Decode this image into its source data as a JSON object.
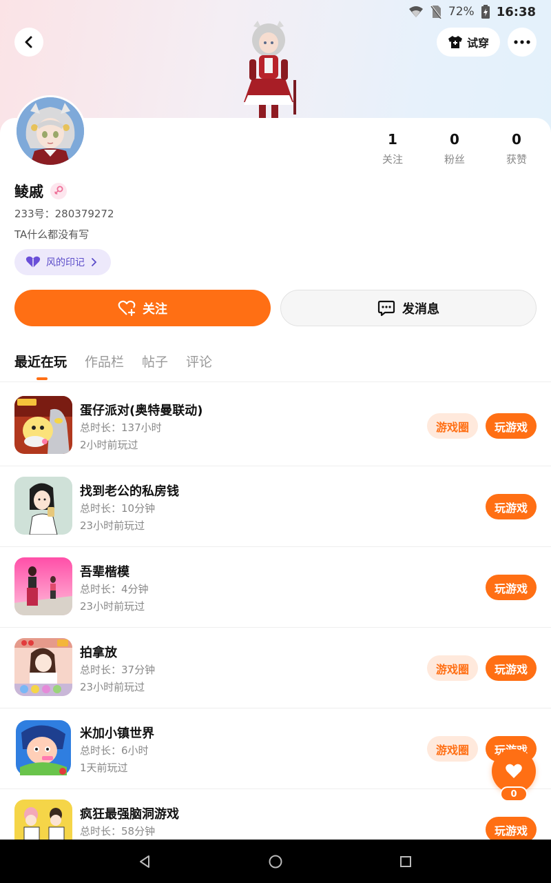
{
  "status_bar": {
    "battery": "72%",
    "time": "16:38"
  },
  "header": {
    "tryon_label": "试穿"
  },
  "profile": {
    "username": "鲮戚",
    "uid": "233号：280379272",
    "bio": "TA什么都没有写",
    "badge_label": "风的印记"
  },
  "stats": [
    {
      "value": "1",
      "label": "关注"
    },
    {
      "value": "0",
      "label": "粉丝"
    },
    {
      "value": "0",
      "label": "获赞"
    }
  ],
  "actions": {
    "follow_label": "关注",
    "message_label": "发消息"
  },
  "tabs": [
    "最近在玩",
    "作品栏",
    "帖子",
    "评论"
  ],
  "games": [
    {
      "title": "蛋仔派对(奥特曼联动)",
      "duration": "总时长：137小时",
      "last_played": "2小时前玩过",
      "has_circle": true
    },
    {
      "title": "找到老公的私房钱",
      "duration": "总时长：10分钟",
      "last_played": "23小时前玩过",
      "has_circle": false
    },
    {
      "title": "吾辈楷模",
      "duration": "总时长：4分钟",
      "last_played": "23小时前玩过",
      "has_circle": false
    },
    {
      "title": "拍拿放",
      "duration": "总时长：37分钟",
      "last_played": "23小时前玩过",
      "has_circle": true
    },
    {
      "title": "米加小镇世界",
      "duration": "总时长：6小时",
      "last_played": "1天前玩过",
      "has_circle": true
    },
    {
      "title": "疯狂最强脑洞游戏",
      "duration": "总时长：58分钟",
      "last_played": "",
      "has_circle": false
    }
  ],
  "game_buttons": {
    "circle_label": "游戏圈",
    "play_label": "玩游戏"
  },
  "like_fab": {
    "count": "0"
  },
  "colors": {
    "accent": "#ff6f14",
    "accent_light": "#ffe9dc",
    "badge_bg": "#ede9fb",
    "badge_text": "#5b4cc9"
  }
}
